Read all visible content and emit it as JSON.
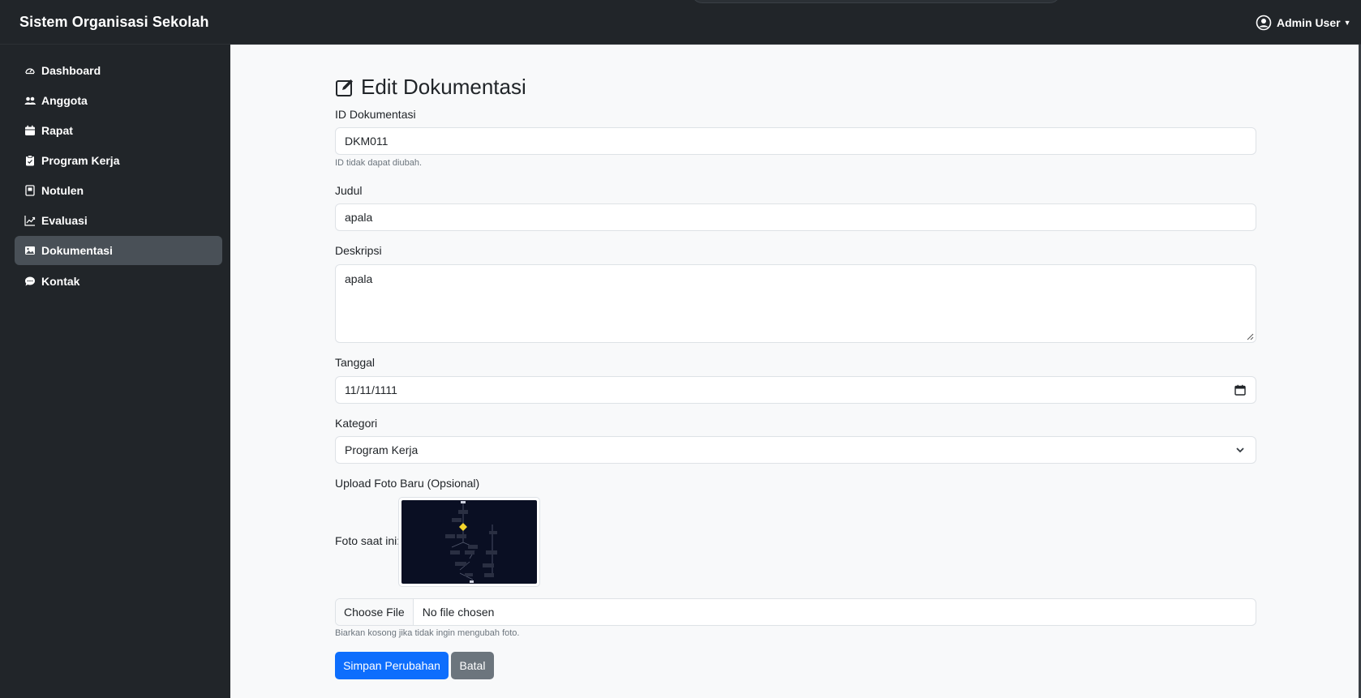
{
  "navbar": {
    "brand": "Sistem Organisasi Sekolah",
    "user_label": "Admin User",
    "user_icon": "user-circle-icon"
  },
  "sidebar": {
    "items": [
      {
        "label": "Dashboard",
        "icon": "speedometer-icon",
        "active": false
      },
      {
        "label": "Anggota",
        "icon": "people-icon",
        "active": false
      },
      {
        "label": "Rapat",
        "icon": "calendar-icon",
        "active": false
      },
      {
        "label": "Program Kerja",
        "icon": "clipboard-icon",
        "active": false
      },
      {
        "label": "Notulen",
        "icon": "journal-icon",
        "active": false
      },
      {
        "label": "Evaluasi",
        "icon": "graph-up-icon",
        "active": false
      },
      {
        "label": "Dokumentasi",
        "icon": "image-icon",
        "active": true
      },
      {
        "label": "Kontak",
        "icon": "chat-icon",
        "active": false
      }
    ]
  },
  "form": {
    "title": "Edit Dokumentasi",
    "id_label": "ID Dokumentasi",
    "id_value": "DKM011",
    "id_hint": "ID tidak dapat diubah.",
    "judul_label": "Judul",
    "judul_value": "apala",
    "deskripsi_label": "Deskripsi",
    "deskripsi_value": "apala",
    "tanggal_label": "Tanggal",
    "tanggal_value": "11/11/1111",
    "kategori_label": "Kategori",
    "kategori_value": "Program Kerja",
    "upload_label": "Upload Foto Baru (Opsional)",
    "current_photo_label": "Foto saat ini:",
    "file_button": "Choose File",
    "file_status": "No file chosen",
    "file_hint": "Biarkan kosong jika tidak ingin mengubah foto.",
    "save_button": "Simpan Perubahan",
    "cancel_button": "Batal"
  },
  "colors": {
    "navbar_bg": "#212529",
    "active_item": "#495057",
    "primary": "#0d6efd",
    "secondary": "#6c757d"
  }
}
